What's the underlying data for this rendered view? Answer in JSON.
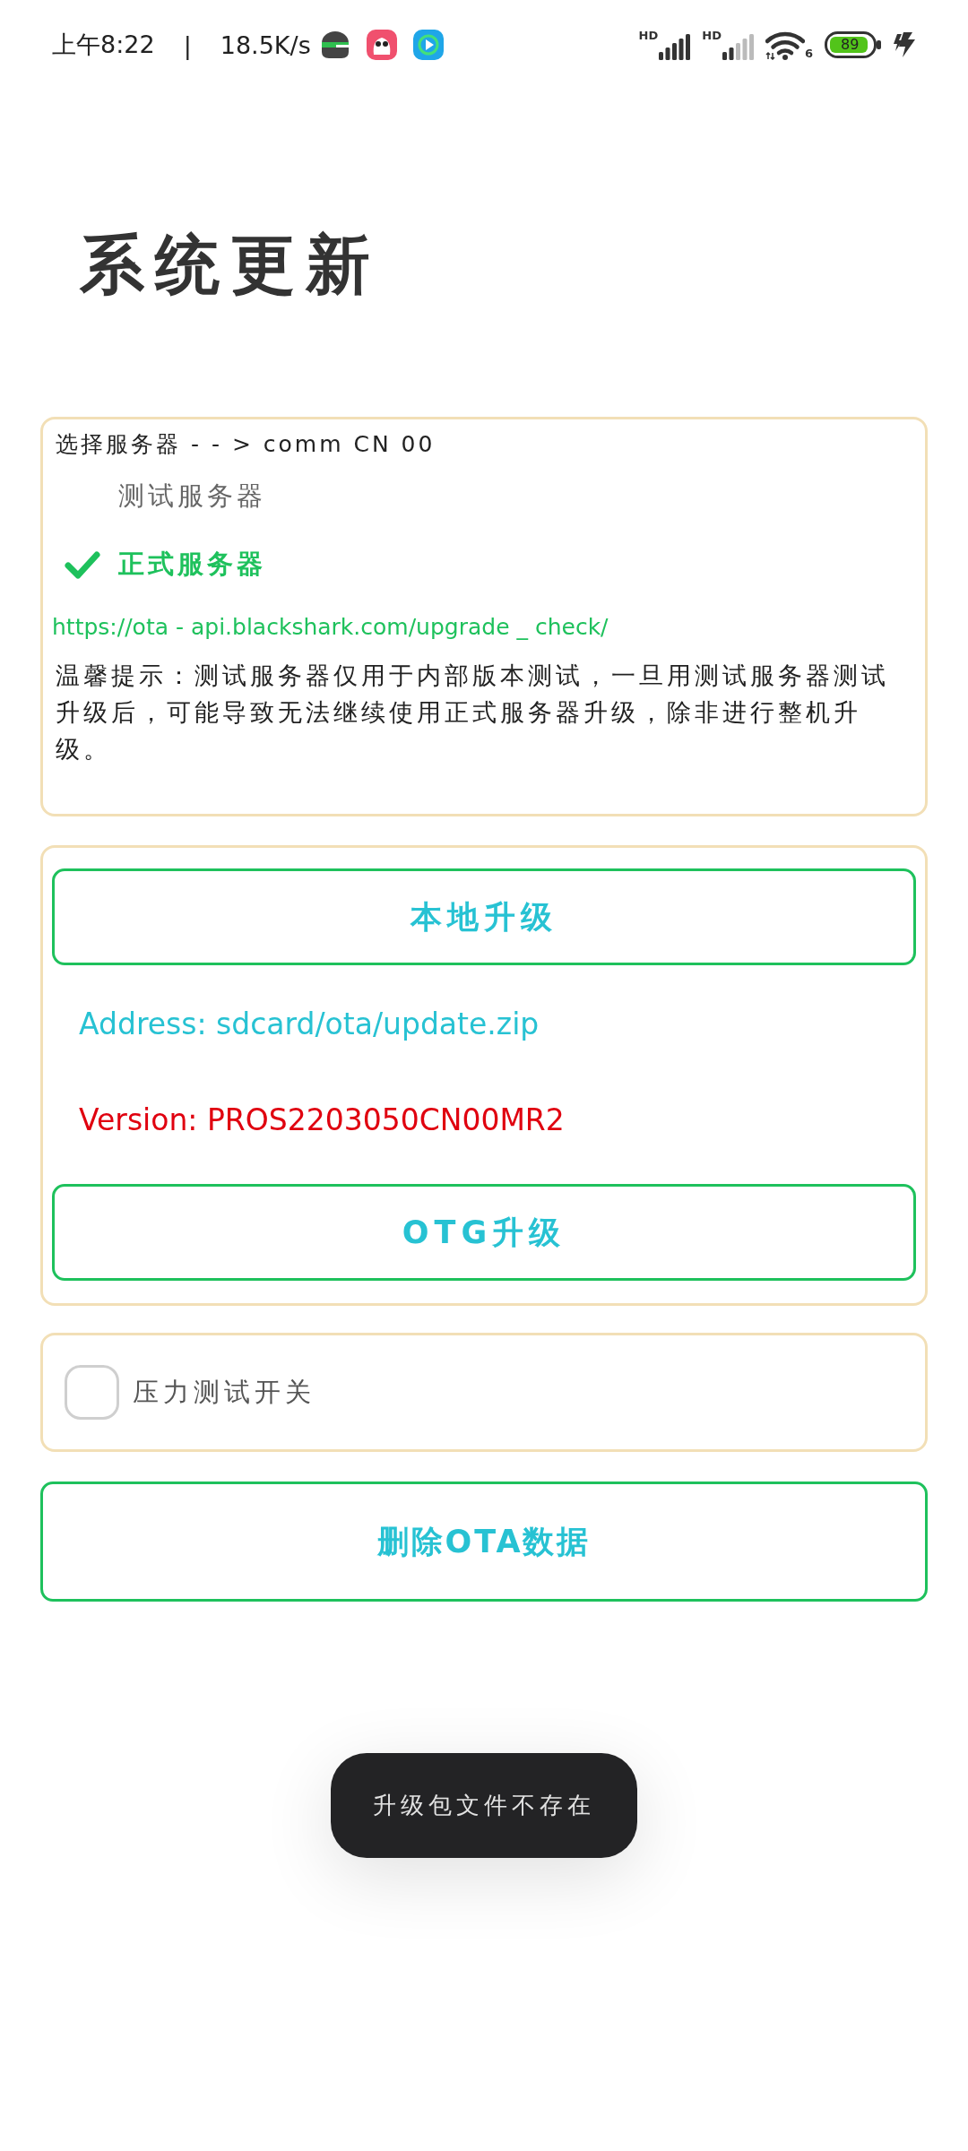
{
  "status_bar": {
    "time": "上午8:22",
    "separator": "|",
    "net_speed": "18.5K/s",
    "sim_labels": [
      "HD",
      "HD"
    ],
    "wifi_label": "6",
    "battery": "89"
  },
  "title": "系统更新",
  "server_card": {
    "header": "选择服务器 - - > comm CN 00",
    "options": [
      {
        "label": "测试服务器",
        "selected": false
      },
      {
        "label": "正式服务器",
        "selected": true
      }
    ],
    "url": "https://ota - api.blackshark.com/upgrade _ check/",
    "notice": "温馨提示：测试服务器仅用于内部版本测试，一旦用测试服务器测试升级后，可能导致无法继续使用正式服务器升级，除非进行整机升级。"
  },
  "upgrade_card": {
    "local_button": "本地升级",
    "address": "Address: sdcard/ota/update.zip",
    "version": "Version: PROS2203050CN00MR2",
    "otg_button": "OTG升级"
  },
  "stress_test": {
    "label": "压力测试开关",
    "checked": false
  },
  "delete_button": "删除OTA数据",
  "toast": "升级包文件不存在"
}
